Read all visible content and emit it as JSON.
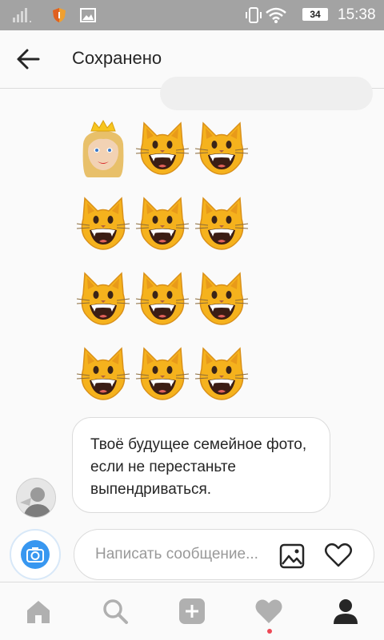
{
  "status_bar": {
    "time": "15:38",
    "battery_level": "34",
    "icons": [
      "signal-icon",
      "shield-icon",
      "image-icon",
      "phone-vibrate-icon",
      "wifi-icon",
      "battery-icon"
    ]
  },
  "header": {
    "title": "Сохранено",
    "back_icon": "arrow-left-icon"
  },
  "emoji_message": {
    "rows": [
      [
        "princess-emoji",
        "grinning-cat-emoji",
        "grinning-cat-emoji"
      ],
      [
        "grinning-cat-emoji",
        "grinning-cat-emoji",
        "grinning-cat-emoji"
      ],
      [
        "grinning-cat-emoji",
        "grinning-cat-emoji",
        "grinning-cat-emoji"
      ],
      [
        "grinning-cat-emoji",
        "grinning-cat-emoji",
        "grinning-cat-emoji"
      ]
    ]
  },
  "message": {
    "text": "Твоё будущее семейное фото, если не перестаньте выпендриваться."
  },
  "composer": {
    "placeholder": "Написать сообщение...",
    "icons": [
      "camera-icon",
      "gallery-icon",
      "heart-outline-icon"
    ]
  },
  "tab_bar": {
    "tabs": [
      "home-icon",
      "search-icon",
      "add-icon",
      "activity-heart-icon",
      "profile-icon"
    ],
    "notification_color": "#ed4956"
  },
  "colors": {
    "accent": "#3897f0",
    "status_bar": "#a3a3a3"
  }
}
